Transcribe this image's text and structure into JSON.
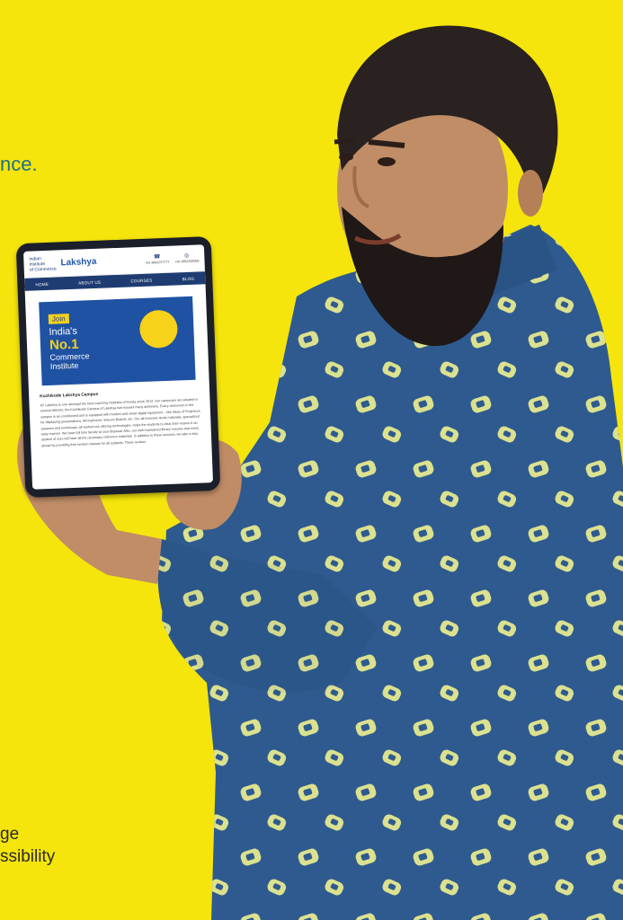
{
  "background_color": "#f5e50c",
  "text_fragments": {
    "top": "nce.",
    "bottom_line1": "ge",
    "bottom_line2": "ssibility"
  },
  "tablet_screen": {
    "logo": {
      "text_line1": "Indian",
      "text_line2": "Institute",
      "text_line3": "of Commerce",
      "brand": "Lakshya"
    },
    "phones": [
      "+91 9061077777",
      "+91 9052284005"
    ],
    "nav": [
      "HOME",
      "ABOUT US",
      "COURSES",
      "BLOG"
    ],
    "banner": {
      "join": "Join",
      "line1": "India's",
      "line2": "No.1",
      "line3": "Commerce",
      "line4": "Institute"
    },
    "article_title": "Kozhikode Lakshya Campus",
    "article_body": "IIC Lakshya is one amongst the best coaching institutes of Kerala since 2013. Our campuses are situated in several districts; the Kozhikode Campus of Lakshya has housed many achievers. Every classroom in the campus is air-conditioned and is equipped with modern and smart digital equipment – like Ideas of Projectors for displaying presentations, Microphones, Wacom Boards, etc. Our all-inclusive study materials, specialized sessions and workshops, all worked out utilizing technologies, helps the students to clear their exams in an easy manner. We have full time faculty at your disposal. Also, our well-maintained library ensures that every student of ours will have all the necessary reference materials. In addition to these services, we take a step ahead by providing free revision classes for all subjects. These revision"
  }
}
